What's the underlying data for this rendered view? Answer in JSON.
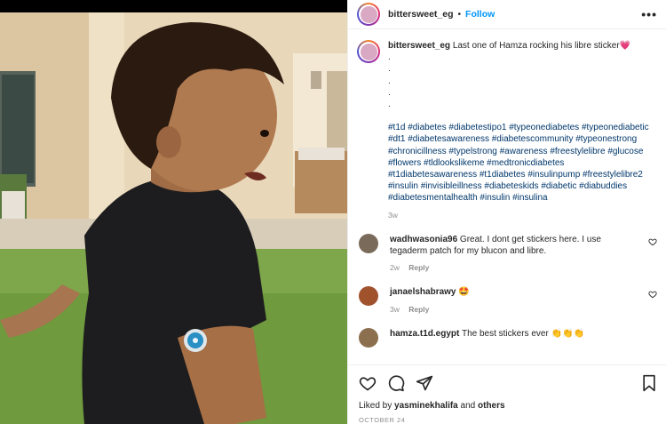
{
  "account": {
    "username": "bittersweet_eg",
    "follow_label": "Follow",
    "separator": "•",
    "more_label": "•••"
  },
  "caption": {
    "username": "bittersweet_eg",
    "text": "Last one of Hamza rocking his libre sticker💗",
    "dots": [
      ".",
      ".",
      ".",
      ".",
      "."
    ],
    "hashtags": "#t1d #diabetes #diabetestipo1 #typeonediabetes #typeonediabetic #dt1 #diabetesawareness #diabetescommunity #typeonestrong #chronicillness #typelstrong #awareness #freestylelibre #glucose #flowers #tldlookslikeme #medtronicdiabetes #t1diabetesawareness #t1diabetes #insulinpump #freestylelibre2 #insulin #invisibleillness #diabeteskids #diabetic #diabuddies #diabetesmentalhealth #insulin #insulina",
    "time": "3w"
  },
  "comments": [
    {
      "username": "wadhwasonia96",
      "text": "Great. I dont get stickers here. I use tegaderm patch for my blucon and libre.",
      "time": "2w",
      "reply_label": "Reply",
      "avatar_color": "#7a6a5a"
    },
    {
      "username": "janaelshabrawy",
      "text": "🤩",
      "time": "3w",
      "reply_label": "Reply",
      "avatar_color": "#a0522d"
    },
    {
      "username": "hamza.t1d.egypt",
      "text": "The best stickers ever 👏👏👏",
      "time": "",
      "reply_label": "",
      "avatar_color": "#8b6f4e"
    }
  ],
  "likes": {
    "prefix": "Liked by",
    "user": "yasminekhalifa",
    "connector": "and",
    "others": "others"
  },
  "date": "OCTOBER 24",
  "icons": [
    "heart-icon",
    "comment-icon",
    "share-icon",
    "save-icon",
    "more-icon"
  ],
  "colors": {
    "link": "#00376b",
    "follow": "#0095f6",
    "muted": "#8e8e8e"
  }
}
